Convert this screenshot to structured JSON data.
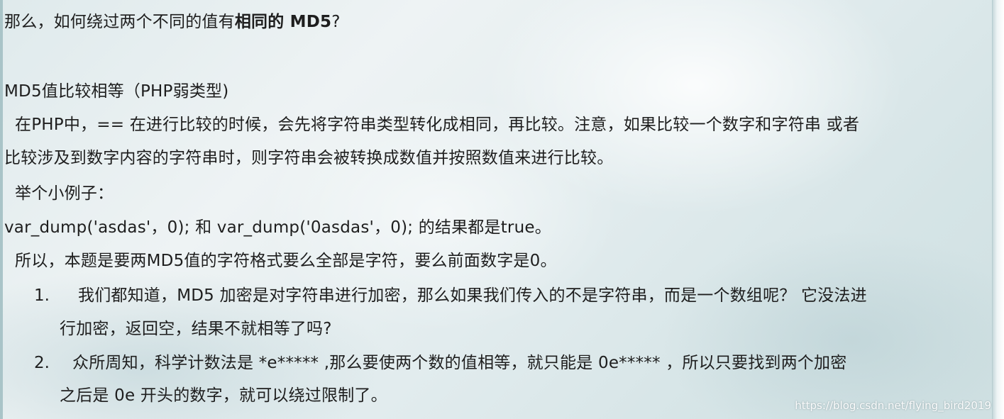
{
  "heading": {
    "prefix": "那么，如何绕过两个不同的值有",
    "bold": "相同的 MD5",
    "suffix": "?"
  },
  "section_title": "MD5值比较相等（PHP弱类型)",
  "para1": {
    "line1": "  在PHP中，== 在进行比较的时候，会先将字符串类型转化成相同，再比较。注意，如果比较一个数字和字符串 或者",
    "line2": "比较涉及到数字内容的字符串时，则字符串会被转换成数值并按照数值来进行比较。"
  },
  "example_intro": "  举个小例子：",
  "example_code": "var_dump('asdas'，0); 和 var_dump('0asdas'，0); 的结果都是true。",
  "conclusion": "  所以，本题是要两MD5值的字符格式要么全部是字符，要么前面数字是0。",
  "list": [
    {
      "number": "1.",
      "line1": "我们都知道，MD5 加密是对字符串进行加密，那么如果我们传入的不是字符串，而是一个数组呢？  它没法进",
      "line2": "行加密，返回空，结果不就相等了吗?"
    },
    {
      "number": "2.",
      "line1": "众所周知，科学计数法是 *e***** ,那么要使两个数的值相等，就只能是 0e***** ，所以只要找到两个加密",
      "line2": "之后是 0e 开头的数字，就可以绕过限制了。"
    }
  ],
  "watermark": "https://blog.csdn.net/flying_bird2019"
}
